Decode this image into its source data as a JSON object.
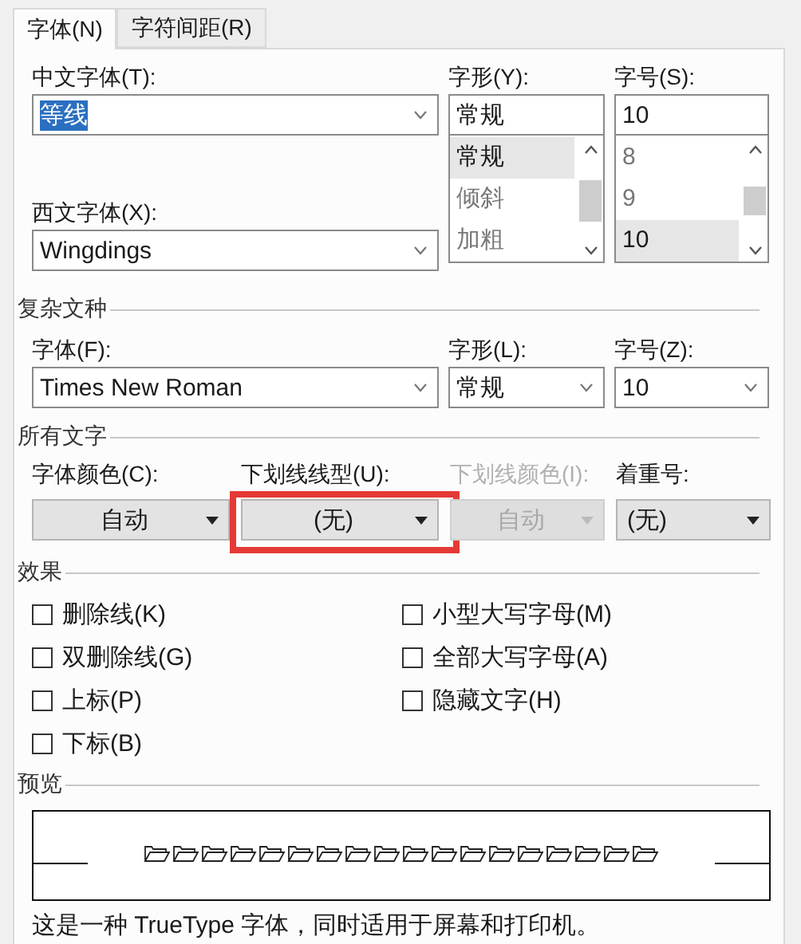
{
  "tabs": [
    {
      "label": "字体(N)",
      "selected": true
    },
    {
      "label": "字符间距(R)",
      "selected": false
    }
  ],
  "font": {
    "chinese_font": {
      "label": "中文字体(T):",
      "value": "等线",
      "value_selected": true
    },
    "western_font": {
      "label": "西文字体(X):",
      "value": "Wingdings"
    },
    "style": {
      "label": "字形(Y):",
      "value": "常规",
      "options": [
        {
          "label": "常规",
          "selected": true
        },
        {
          "label": "倾斜",
          "selected": false
        },
        {
          "label": "加粗",
          "selected": false
        }
      ]
    },
    "size": {
      "label": "字号(S):",
      "value": "10",
      "options": [
        {
          "label": "8",
          "selected": false
        },
        {
          "label": "9",
          "selected": false
        },
        {
          "label": "10",
          "selected": true
        }
      ]
    }
  },
  "complex_scripts": {
    "title": "复杂文种",
    "font": {
      "label": "字体(F):",
      "value": "Times New Roman"
    },
    "style": {
      "label": "字形(L):",
      "value": "常规"
    },
    "size": {
      "label": "字号(Z):",
      "value": "10"
    }
  },
  "all_text": {
    "title": "所有文字",
    "controls": [
      {
        "label": "字体颜色(C):",
        "value": "自动",
        "kind": "centered",
        "disabled": false,
        "highlighted": false
      },
      {
        "label": "下划线线型(U):",
        "value": "(无)",
        "kind": "centered",
        "disabled": false,
        "highlighted": true
      },
      {
        "label": "下划线颜色(I):",
        "value": "自动",
        "kind": "centered",
        "disabled": true,
        "highlighted": false
      },
      {
        "label": "着重号:",
        "value": "(无)",
        "kind": "plain",
        "disabled": false,
        "highlighted": false
      }
    ]
  },
  "effects": {
    "title": "效果",
    "columns": [
      [
        {
          "label": "删除线(K)",
          "checked": false
        },
        {
          "label": "双删除线(G)",
          "checked": false
        },
        {
          "label": "上标(P)",
          "checked": false
        },
        {
          "label": "下标(B)",
          "checked": false
        }
      ],
      [
        {
          "label": "小型大写字母(M)",
          "checked": false
        },
        {
          "label": "全部大写字母(A)",
          "checked": false
        },
        {
          "label": "隐藏文字(H)",
          "checked": false
        }
      ]
    ]
  },
  "preview": {
    "title": "预览",
    "note": "这是一种 TrueType 字体，同时适用于屏幕和打印机。"
  }
}
